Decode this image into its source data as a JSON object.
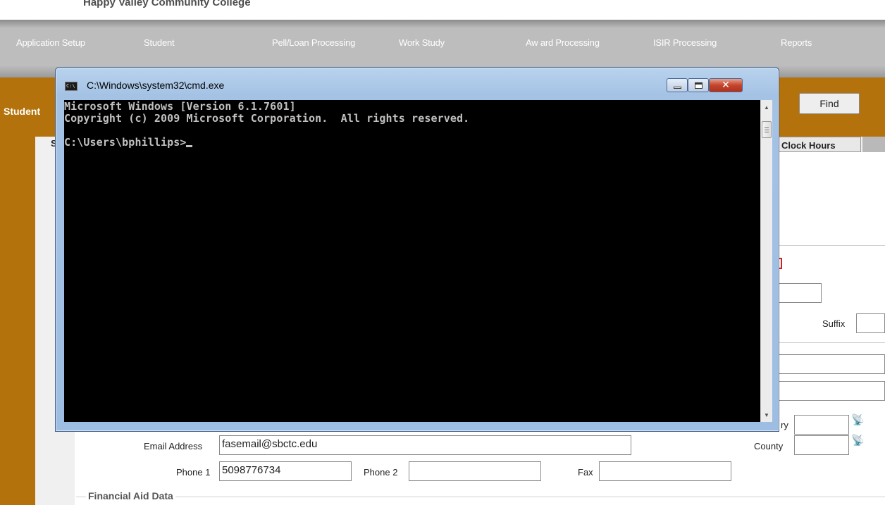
{
  "app": {
    "college_name": "Happy Valley Community College"
  },
  "menu": {
    "items": [
      {
        "label": "Application Setup"
      },
      {
        "label": "Student"
      },
      {
        "label": "Pell/Loan Processing"
      },
      {
        "label": "Work Study"
      },
      {
        "label": "Aw ard Processing"
      },
      {
        "label": "ISIR Processing"
      },
      {
        "label": "Reports"
      }
    ]
  },
  "student_section": {
    "label": "Student",
    "find_label": "Find",
    "tab_s": "S",
    "tab_clock_hours": "Clock Hours"
  },
  "form": {
    "suffix_label": "Suffix",
    "country_label_fragment": "ry",
    "email_label": "Email Address",
    "email_value": "fasemail@sbctc.edu",
    "county_label": "County",
    "phone1_label": "Phone 1",
    "phone1_value": "5098776734",
    "phone2_label": "Phone 2",
    "phone2_value": "",
    "fax_label": "Fax",
    "fax_value": "",
    "financial_aid_title": "Financial Aid Data"
  },
  "cmd": {
    "title": "C:\\Windows\\system32\\cmd.exe",
    "icon": "cmd-app-icon",
    "lines": [
      "Microsoft Windows [Version 6.1.7601]",
      "Copyright (c) 2009 Microsoft Corporation.  All rights reserved.",
      "",
      "C:\\Users\\bphillips>"
    ]
  },
  "colors": {
    "frame_orange": "#b4720c",
    "menu_gray": "#bdbdbd",
    "console_bg": "#000000",
    "console_text": "#c0c0c0"
  }
}
